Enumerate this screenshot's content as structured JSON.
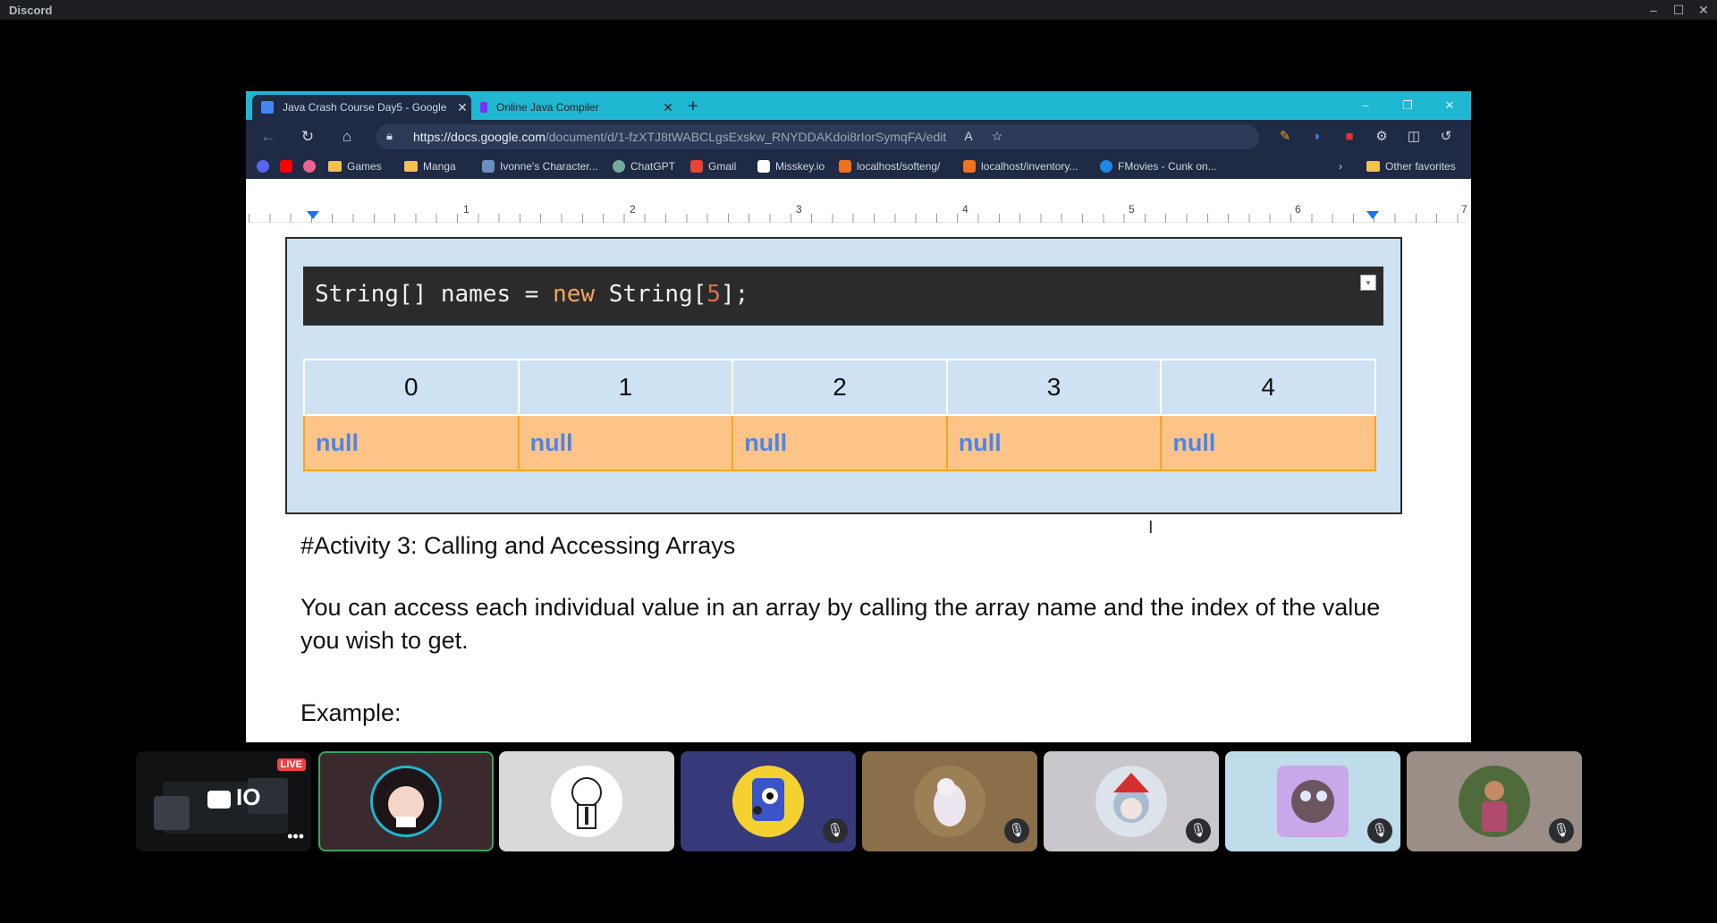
{
  "app": {
    "title": "Discord"
  },
  "browser": {
    "tabs": [
      {
        "label": "Java Crash Course Day5 - Google",
        "icon": "google-docs-icon"
      },
      {
        "label": "Online Java Compiler",
        "icon": "compiler-icon"
      }
    ],
    "url_host": "https://docs.google.com",
    "url_path": "/document/d/1-fzXTJ8tWABCLgsExskw_RNYDDAKdoi8rIorSymqFA/edit",
    "bookmarks": [
      {
        "label": "Games"
      },
      {
        "label": "Manga"
      },
      {
        "label": "Ivonne's Character..."
      },
      {
        "label": "ChatGPT"
      },
      {
        "label": "Gmail"
      },
      {
        "label": "Misskey.io"
      },
      {
        "label": "localhost/softeng/"
      },
      {
        "label": "localhost/inventory..."
      },
      {
        "label": "FMovies - Cunk on..."
      }
    ],
    "other_favorites": "Other favorites"
  },
  "ruler": {
    "numbers": [
      "1",
      "2",
      "3",
      "4",
      "5",
      "6",
      "7"
    ]
  },
  "document": {
    "code_parts": {
      "a": "String[] names = ",
      "kw": "new",
      "b": " String[",
      "num": "5",
      "c": "];"
    },
    "indices": [
      "0",
      "1",
      "2",
      "3",
      "4"
    ],
    "values": [
      "null",
      "null",
      "null",
      "null",
      "null"
    ],
    "heading": "#Activity 3: Calling and Accessing Arrays",
    "paragraph": "You can access each individual value in an array by calling the array name and the index of the value you wish to get.",
    "example_label": "Example:"
  },
  "participants": {
    "live_badge": "LIVE",
    "stream_label": "IO",
    "colors": {
      "accent_green": "#3ba55d",
      "live_red": "#ed4245"
    }
  }
}
